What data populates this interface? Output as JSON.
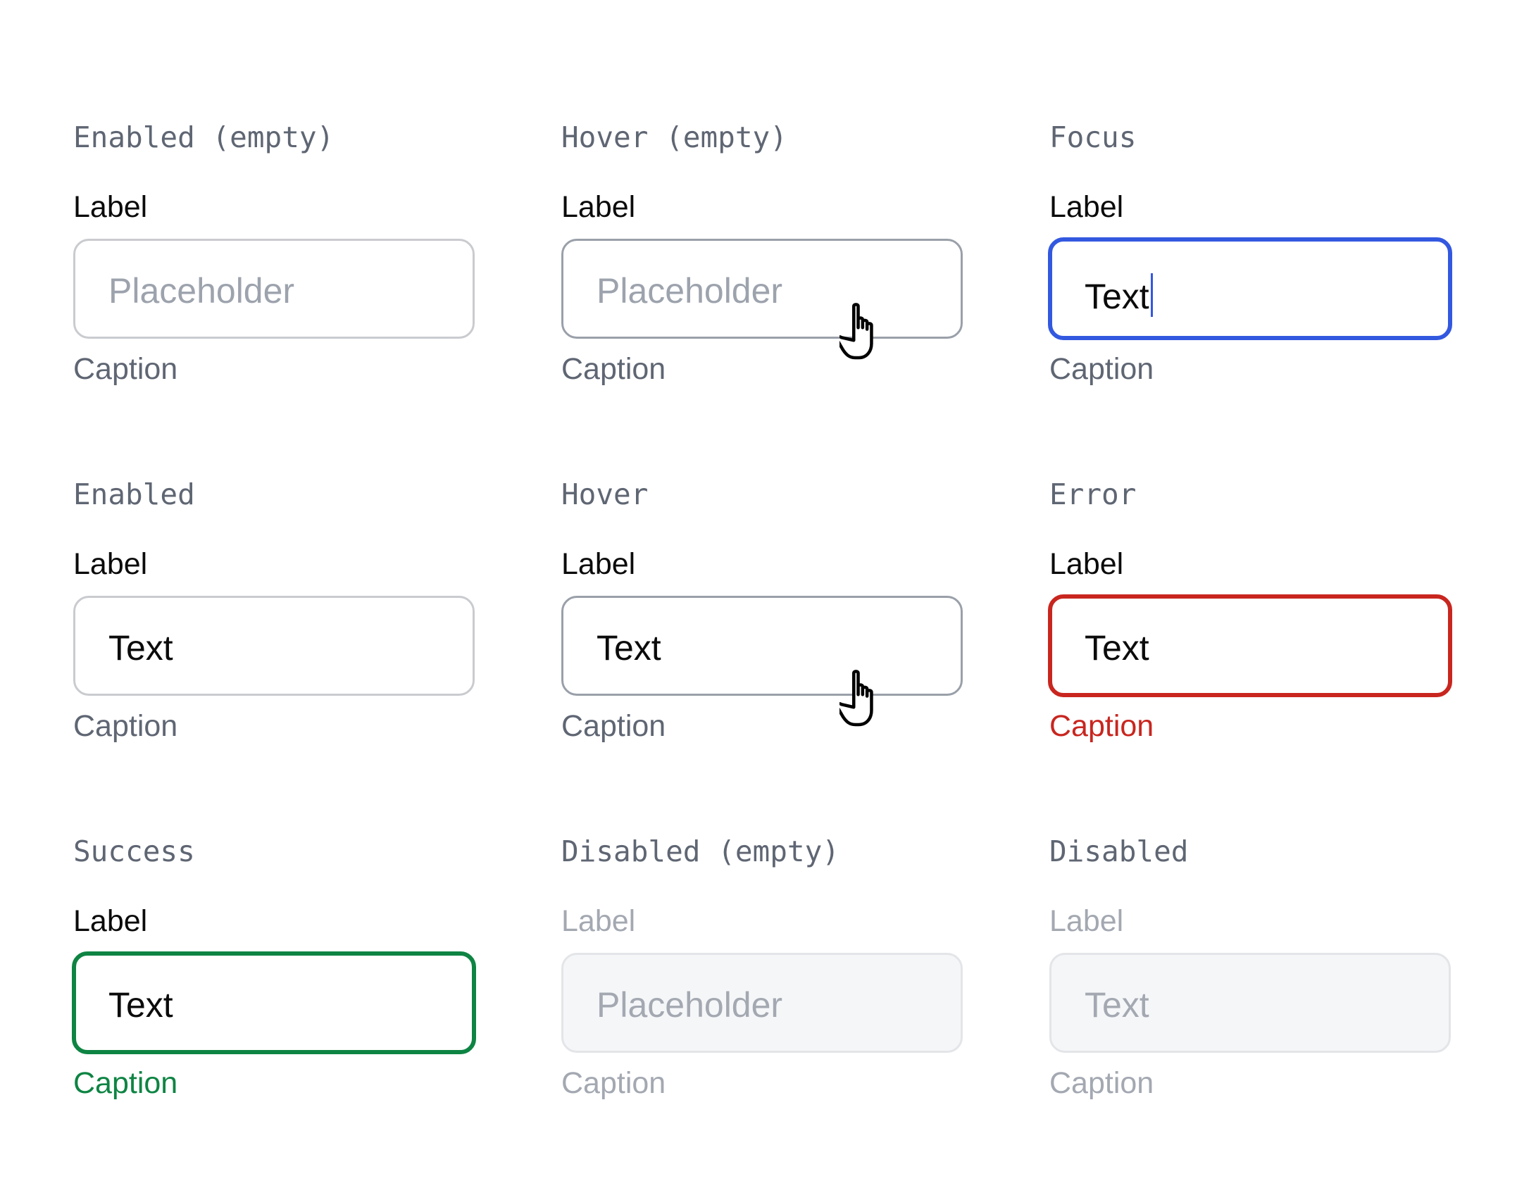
{
  "colors": {
    "focus": "#3358e0",
    "error": "#c8261f",
    "success": "#0e8443",
    "muted": "#5f6673",
    "placeholder": "#9da3ad"
  },
  "cells": [
    {
      "state": "Enabled (empty)",
      "label": "Label",
      "value": "Placeholder",
      "is_placeholder": true,
      "caption": "Caption",
      "variant": "enabled",
      "cursor": false
    },
    {
      "state": "Hover (empty)",
      "label": "Label",
      "value": "Placeholder",
      "is_placeholder": true,
      "caption": "Caption",
      "variant": "hover",
      "cursor": "hand-pointer-icon"
    },
    {
      "state": "Focus",
      "label": "Label",
      "value": "Text",
      "is_placeholder": false,
      "caption": "Caption",
      "variant": "focus",
      "cursor": false
    },
    {
      "state": "Enabled",
      "label": "Label",
      "value": "Text",
      "is_placeholder": false,
      "caption": "Caption",
      "variant": "enabled",
      "cursor": false
    },
    {
      "state": "Hover",
      "label": "Label",
      "value": "Text",
      "is_placeholder": false,
      "caption": "Caption",
      "variant": "hover",
      "cursor": "hand-pointer-icon"
    },
    {
      "state": "Error",
      "label": "Label",
      "value": "Text",
      "is_placeholder": false,
      "caption": "Caption",
      "variant": "error",
      "cursor": false
    },
    {
      "state": "Success",
      "label": "Label",
      "value": "Text",
      "is_placeholder": false,
      "caption": "Caption",
      "variant": "success",
      "cursor": false
    },
    {
      "state": "Disabled (empty)",
      "label": "Label",
      "value": "Placeholder",
      "is_placeholder": true,
      "caption": "Caption",
      "variant": "disabled",
      "cursor": false
    },
    {
      "state": "Disabled",
      "label": "Label",
      "value": "Text",
      "is_placeholder": false,
      "caption": "Caption",
      "variant": "disabled",
      "cursor": false
    }
  ]
}
